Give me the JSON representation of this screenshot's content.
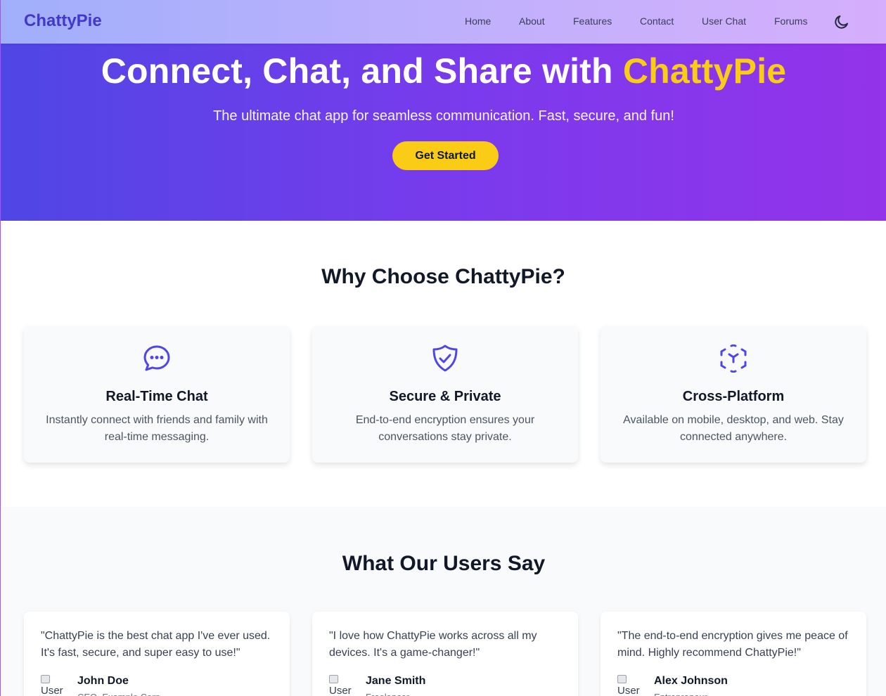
{
  "nav": {
    "brand": "ChattyPie",
    "links": [
      "Home",
      "About",
      "Features",
      "Contact",
      "User Chat",
      "Forums"
    ],
    "theme_icon": "moon-icon"
  },
  "hero": {
    "title_main": "Connect, Chat, and Share with ",
    "title_accent": "ChattyPie",
    "subtitle": "The ultimate chat app for seamless communication. Fast, secure, and fun!",
    "cta_label": "Get Started"
  },
  "features": {
    "heading": "Why Choose ChattyPie?",
    "items": [
      {
        "icon": "chat-bubble-icon",
        "title": "Real-Time Chat",
        "desc": "Instantly connect with friends and family with real-time messaging."
      },
      {
        "icon": "shield-check-icon",
        "title": "Secure & Private",
        "desc": "End-to-end encryption ensures your conversations stay private."
      },
      {
        "icon": "cube-icon",
        "title": "Cross-Platform",
        "desc": "Available on mobile, desktop, and web. Stay connected anywhere."
      }
    ]
  },
  "testimonials": {
    "heading": "What Our Users Say",
    "items": [
      {
        "quote": "\"ChattyPie is the best chat app I've ever used. It's fast, secure, and super easy to use!\"",
        "name": "John Doe",
        "role": "CEO, Example Corp",
        "avatar_alt": "User"
      },
      {
        "quote": "\"I love how ChattyPie works across all my devices. It's a game-changer!\"",
        "name": "Jane Smith",
        "role": "Freelancer",
        "avatar_alt": "User"
      },
      {
        "quote": "\"The end-to-end encryption gives me peace of mind. Highly recommend ChattyPie!\"",
        "name": "Alex Johnson",
        "role": "Entrepreneur",
        "avatar_alt": "User"
      }
    ]
  },
  "colors": {
    "brand": "#4338ca",
    "accent": "#facc15",
    "hero_start": "#4f46e5",
    "hero_end": "#9333ea"
  }
}
